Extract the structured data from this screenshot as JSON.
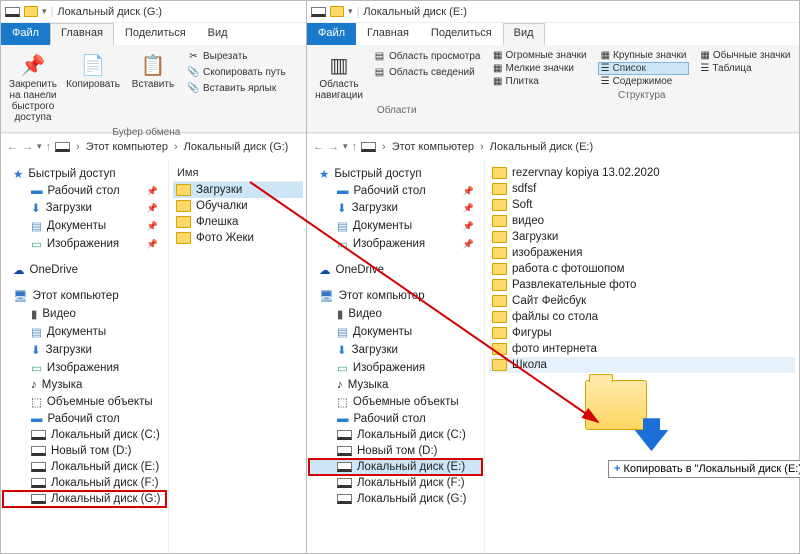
{
  "w1": {
    "title": "Локальный диск (G:)",
    "tabs": {
      "file": "Файл",
      "main": "Главная",
      "share": "Поделиться",
      "view": "Вид"
    },
    "ribbon": {
      "pin": "Закрепить на панели быстрого доступа",
      "copy": "Копировать",
      "paste": "Вставить",
      "cut": "Вырезать",
      "copyPath": "Скопировать путь",
      "pasteShortcut": "Вставить ярлык",
      "groupLabel": "Буфер обмена"
    },
    "breadcrumb": {
      "pc": "Этот компьютер",
      "drive": "Локальный диск (G:)"
    },
    "tree": {
      "quick": "Быстрый доступ",
      "desktop": "Рабочий стол",
      "downloads": "Загрузки",
      "documents": "Документы",
      "pictures": "Изображения",
      "onedrive": "OneDrive",
      "thispc": "Этот компьютер",
      "video": "Видео",
      "docs2": "Документы",
      "dl2": "Загрузки",
      "pics2": "Изображения",
      "music": "Музыка",
      "objects": "Объемные объекты",
      "desk2": "Рабочий стол",
      "dc": "Локальный диск (C:)",
      "dd": "Новый том (D:)",
      "de": "Локальный диск (E:)",
      "df": "Локальный диск (F:)",
      "dg": "Локальный диск (G:)"
    },
    "colHead": "Имя",
    "files": [
      "Загрузки",
      "Обучалки",
      "Флешка",
      "Фото Жеки"
    ]
  },
  "w2": {
    "title": "Локальный диск (E:)",
    "tabs": {
      "file": "Файл",
      "main": "Главная",
      "share": "Поделиться",
      "view": "Вид"
    },
    "ribbon": {
      "navPane": "Область навигации",
      "preview": "Область просмотра",
      "details": "Область сведений",
      "group1": "Области",
      "huge": "Огромные значки",
      "large": "Крупные значки",
      "normal": "Обычные значки",
      "small": "Мелкие значки",
      "list": "Список",
      "table": "Таблица",
      "tiles": "Плитка",
      "content": "Содержимое",
      "group2": "Структура"
    },
    "breadcrumb": {
      "pc": "Этот компьютер",
      "drive": "Локальный диск (E:)"
    },
    "tree": {
      "quick": "Быстрый доступ",
      "desktop": "Рабочий стол",
      "downloads": "Загрузки",
      "documents": "Документы",
      "pictures": "Изображения",
      "onedrive": "OneDrive",
      "thispc": "Этот компьютер",
      "video": "Видео",
      "docs2": "Документы",
      "dl2": "Загрузки",
      "pics2": "Изображения",
      "music": "Музыка",
      "objects": "Объемные объекты",
      "desk2": "Рабочий стол",
      "dc": "Локальный диск (C:)",
      "dd": "Новый том (D:)",
      "de": "Локальный диск (E:)",
      "df": "Локальный диск (F:)",
      "dg": "Локальный диск (G:)"
    },
    "files": [
      "rezervnay kopiya 13.02.2020",
      "sdfsf",
      "Soft",
      "видео",
      "Загрузки",
      "изображения",
      "работа с фотошопом",
      "Развлекательные фото",
      "Сайт Фейсбук",
      "файлы со стола",
      "Фигуры",
      "фото интернета",
      "Школа"
    ],
    "tooltip": "Копировать в \"Локальный диск (E:)\""
  }
}
